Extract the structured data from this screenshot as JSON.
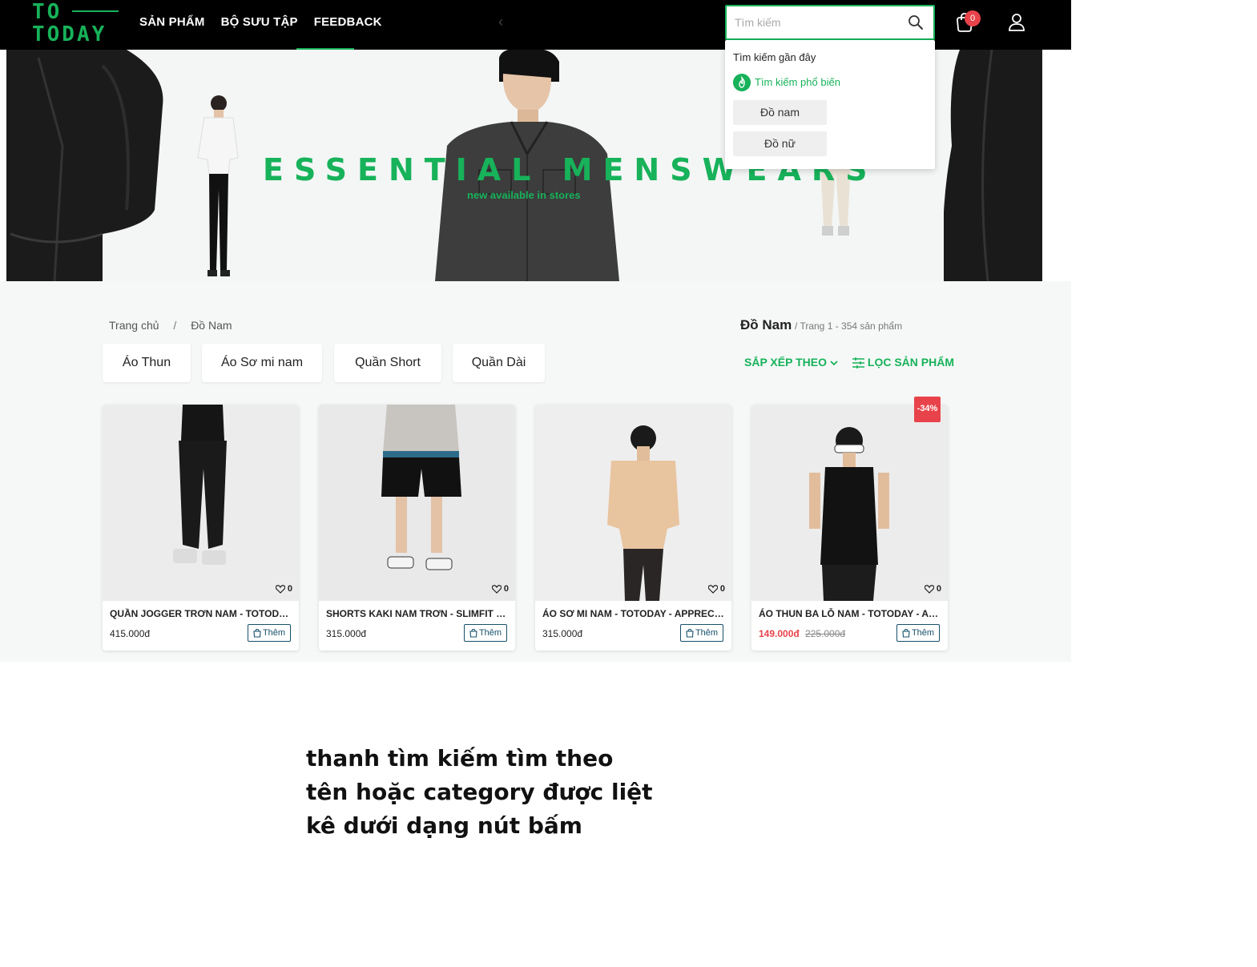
{
  "header": {
    "logo_line1": "TO",
    "logo_line2": "TODAY",
    "nav": [
      {
        "label": "SẢN PHẨM"
      },
      {
        "label": "BỘ SƯU TẬP"
      },
      {
        "label": "FEEDBACK"
      }
    ],
    "search_placeholder": "Tìm kiếm",
    "cart_count": "0"
  },
  "banner": {
    "title": "ESSENTIAL MENSWEARS",
    "subtitle": "new available in stores"
  },
  "search_dropdown": {
    "recent_label": "Tìm kiếm gần đây",
    "popular_label": "Tìm kiếm phổ biến",
    "chips": [
      "Đồ nam",
      "Đồ nữ"
    ]
  },
  "breadcrumb": [
    "Trang chủ",
    "/",
    "Đồ Nam"
  ],
  "page": {
    "title": "Đồ Nam",
    "info": "/ Trang 1 - 354 sản phẩm"
  },
  "categories": [
    "Áo Thun",
    "Áo Sơ mi nam",
    "Quần Short",
    "Quần Dài"
  ],
  "toolbar": {
    "sort_label": "SẮP XẾP THEO",
    "filter_label": "LỌC SẢN PHẨM"
  },
  "products": [
    {
      "name": "QUẦN JOGGER TRƠN NAM - TOTODAY - CARGO",
      "price": "415.000đ",
      "likes": "0",
      "add_label": "Thêm"
    },
    {
      "name": "SHORTS KAKI NAM TRƠN - SLIMFIT - TOTODAY",
      "price": "315.000đ",
      "likes": "0",
      "add_label": "Thêm"
    },
    {
      "name": "ÁO SƠ MI NAM - TOTODAY - APPRECIATE",
      "price": "315.000đ",
      "likes": "0",
      "add_label": "Thêm"
    },
    {
      "name": "ÁO THUN BA LỖ NAM - TOTODAY - ANOTHER",
      "price": "149.000đ",
      "old_price": "225.000đ",
      "discount": "-34%",
      "likes": "0",
      "add_label": "Thêm"
    }
  ],
  "annotation": "thanh tìm kiếm tìm theo tên hoặc category được liệt kê dưới dạng nút bấm",
  "colors": {
    "accent": "#17b25a",
    "header_bg": "#000000",
    "sale": "#e8434a",
    "page_bg": "#f6f8f7"
  }
}
